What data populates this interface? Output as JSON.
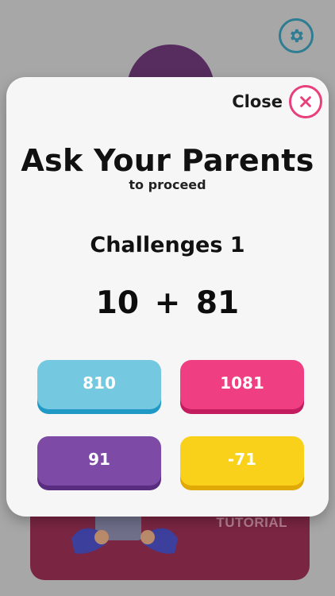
{
  "background": {
    "card_label": "TUTORIAL"
  },
  "dialog": {
    "close_label": "Close",
    "title": "Ask Your Parents",
    "subtitle": "to proceed",
    "challenge_label": "Challenges 1",
    "equation": "10 + 81",
    "answers": [
      {
        "label": "810",
        "color": "#74c8e0"
      },
      {
        "label": "1081",
        "color": "#ef3f82"
      },
      {
        "label": "91",
        "color": "#7d4aa6"
      },
      {
        "label": "-71",
        "color": "#f9d11b"
      }
    ]
  },
  "colors": {
    "close_accent": "#e7407c",
    "modal_bg": "#f6f6f6",
    "overlay_bg": "#a7a7a7"
  },
  "icons": {
    "settings": "gear-icon",
    "close": "close-icon"
  }
}
